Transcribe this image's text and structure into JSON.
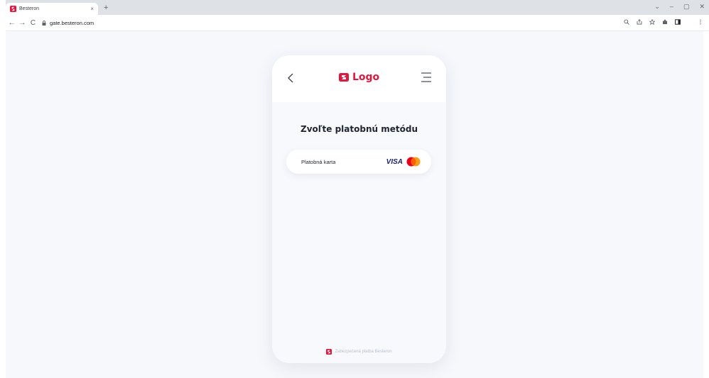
{
  "browser": {
    "tab_title": "Besteron",
    "tab_close": "×",
    "new_tab": "+",
    "url": "gate.besteron.com",
    "nav": {
      "back": "←",
      "forward": "→",
      "reload": "C"
    },
    "window_controls": {
      "dropdown": "⌄",
      "minimize": "–",
      "restore": "▢",
      "close": "✕"
    }
  },
  "app": {
    "logo_text": "Logo",
    "heading": "Zvoľte platobnú metódu",
    "payment_methods": [
      {
        "label": "Platobná karta",
        "brand_text": "VISA"
      }
    ],
    "footer_text": "Zabezpečená platba Besteron"
  },
  "colors": {
    "brand": "#e6153b",
    "visa": "#1a1f71",
    "mastercard_red": "#eb001b",
    "mastercard_orange": "#f79e1b",
    "page_bg": "#f6f8fc"
  }
}
